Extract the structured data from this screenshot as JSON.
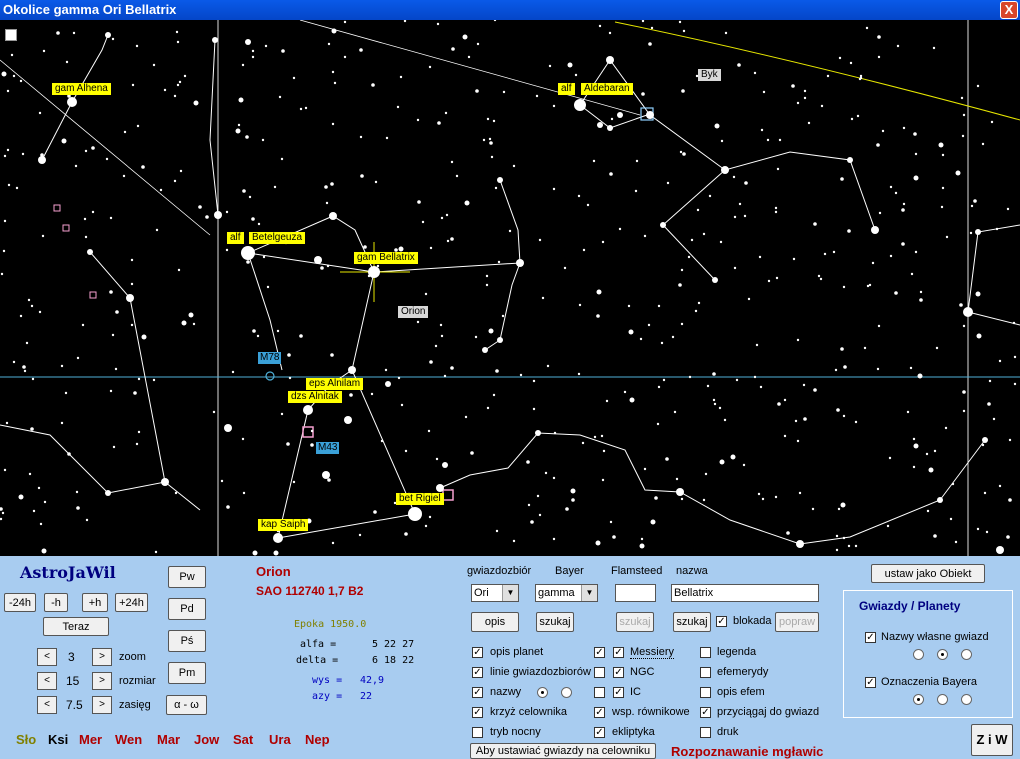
{
  "window": {
    "title": "Okolice gamma   Ori Bellatrix",
    "close": "X"
  },
  "sky": {
    "labels": {
      "gam_alhena": "gam Alhena",
      "alf_aldebaran_a": "alf",
      "alf_aldebaran_b": "Aldebaran",
      "byk": "Byk",
      "alf_betelgeuza_a": "alf",
      "alf_betelgeuza_b": "Betelgeuza",
      "gam_bellatrix": "gam Bellatrix",
      "orion": "Orion",
      "m78": "M78",
      "eps_alnilam": "eps  Alnilam",
      "dzs_alnitak": "dzs  Alnitak",
      "m43": "M43",
      "bet_rigel": "bet  Rigiel",
      "kap_saiph": "kap Saiph"
    },
    "line_colors": {
      "constellation": "#ffffff",
      "crosshair": "#4fb0d8",
      "ecliptic": "#e6e600"
    }
  },
  "panel": {
    "app_name": "AstroJaWil",
    "time_buttons": [
      "-24h",
      "-h",
      "+h",
      "+24h"
    ],
    "now_button": "Teraz",
    "zoom": {
      "left": "<",
      "value": "3",
      "right": ">",
      "label": "zoom"
    },
    "size": {
      "left": "<",
      "value": "15",
      "right": ">",
      "label": "rozmiar"
    },
    "range": {
      "left": "<",
      "value": "7.5",
      "right": ">",
      "label": "zasięg"
    },
    "side_buttons": [
      "Pw",
      "Pd",
      "Pś",
      "Pm",
      "α - ω"
    ],
    "object": {
      "constellation": "Orion",
      "sao": "SAO 112740  1,7  B2",
      "epoch": "Epoka 1950.0",
      "alfa_label": "alfa =",
      "alfa_value": "5 22 27",
      "delta_label": "delta =",
      "delta_value": "6 18 22",
      "wys_label": "wys =",
      "wys_value": "42,9",
      "azy_label": "azy =",
      "azy_value": "22"
    },
    "search": {
      "headers": [
        "gwiazdozbiór",
        "Bayer",
        "Flamsteed",
        "nazwa"
      ],
      "constellation_value": "Ori",
      "bayer_value": "gamma",
      "flamsteed_value": "",
      "name_value": "Bellatrix",
      "opis": "opis",
      "szukaj1": "szukaj",
      "szukaj2": "szukaj",
      "szukaj3": "szukaj",
      "blokada": "blokada",
      "popraw": "popraw"
    },
    "options": {
      "col1": [
        "opis planet",
        "linie gwiazdozbiorów",
        "nazwy",
        "krzyż celownika",
        "tryb nocny"
      ],
      "col2": [
        "Messiery",
        "NGC",
        "IC",
        "wsp. równikowe",
        "ekliptyka"
      ],
      "col3": [
        "legenda",
        "efemerydy",
        "opis efem",
        "przyciągaj do gwiazd",
        "druk"
      ]
    },
    "set_object": "ustaw jako Obiekt",
    "stars_planets": {
      "title": "Gwiazdy / Planety",
      "opt1": "Nazwy własne gwiazd",
      "opt2": "Oznaczenia Bayera"
    },
    "aim_button": "Aby ustawiać gwiazdy na celowniku",
    "nebula_text": "Rozpoznawanie mgławic",
    "ziw": "Z i W",
    "planets": [
      {
        "label": "Sło",
        "color": "#808000"
      },
      {
        "label": "Ksi",
        "color": "#000000"
      },
      {
        "label": "Mer",
        "color": "#b00000"
      },
      {
        "label": "Wen",
        "color": "#b00000"
      },
      {
        "label": "Mar",
        "color": "#b00000"
      },
      {
        "label": "Jow",
        "color": "#b00000"
      },
      {
        "label": "Sat",
        "color": "#b00000"
      },
      {
        "label": "Ura",
        "color": "#b00000"
      },
      {
        "label": "Nep",
        "color": "#b00000"
      }
    ]
  }
}
